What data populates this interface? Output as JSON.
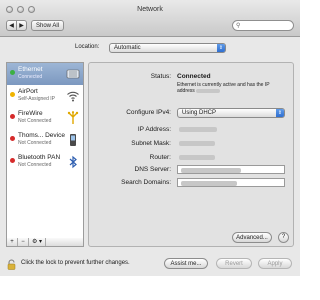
{
  "window": {
    "title": "Network",
    "show_all": "Show All",
    "back_icon": "chevron-left-icon",
    "forward_icon": "chevron-right-icon",
    "search_icon": "search-icon"
  },
  "location": {
    "label": "Location:",
    "value": "Automatic"
  },
  "sidebar": {
    "items": [
      {
        "name": "Ethernet",
        "status": "Connected",
        "dot_color": "#3cb043",
        "icon": "ethernet-icon",
        "selected": true
      },
      {
        "name": "AirPort",
        "status": "Self-Assigned IP",
        "dot_color": "#f0b400",
        "icon": "wifi-icon",
        "selected": false
      },
      {
        "name": "FireWire",
        "status": "Not Connected",
        "dot_color": "#d62b2b",
        "icon": "firewire-icon",
        "selected": false
      },
      {
        "name": "Thoms... Device",
        "status": "Not Connected",
        "dot_color": "#d62b2b",
        "icon": "phone-icon",
        "selected": false
      },
      {
        "name": "Bluetooth PAN",
        "status": "Not Connected",
        "dot_color": "#d62b2b",
        "icon": "bluetooth-icon",
        "selected": false
      }
    ],
    "add_label": "+",
    "remove_label": "−",
    "action_label": "⚙ ▾"
  },
  "detail": {
    "status_label": "Status:",
    "status_value": "Connected",
    "status_desc": "Ethernet is currently active and has the IP address",
    "configure_label": "Configure IPv4:",
    "configure_value": "Using DHCP",
    "ip_label": "IP Address:",
    "subnet_label": "Subnet Mask:",
    "router_label": "Router:",
    "dns_label": "DNS Server:",
    "search_domains_label": "Search Domains:",
    "advanced_label": "Advanced...",
    "help_label": "?"
  },
  "footer": {
    "lock_text": "Click the lock to prevent further changes.",
    "assist_label": "Assist me...",
    "revert_label": "Revert",
    "apply_label": "Apply"
  },
  "colors": {
    "accent": "#2f6fd0",
    "selection": "#7c98c0"
  }
}
